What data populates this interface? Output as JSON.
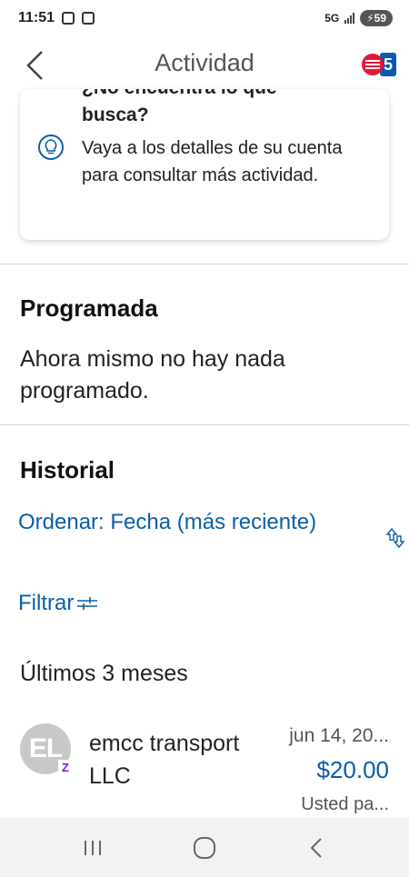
{
  "status_bar": {
    "time": "11:51",
    "network": "5G",
    "battery": "59"
  },
  "header": {
    "title": "Actividad",
    "logo_badge": "5",
    "logo_color": "#e31837",
    "badge_color": "#0b59b5"
  },
  "info_card": {
    "title_cut": "¿No encuentra lo que",
    "title": "busca?",
    "text": "Vaya a los detalles de su cuenta para consultar más actividad.",
    "icon": "lightbulb-icon"
  },
  "scheduled": {
    "heading": "Programada",
    "message": "Ahora mismo no hay nada programado."
  },
  "history": {
    "heading": "Historial",
    "sort_label": "Ordenar: Fecha (más reciente)",
    "filter_label": "Filtrar",
    "period": "Últimos 3 meses"
  },
  "transactions": [
    {
      "initials": "EL",
      "name": "emcc transport LLC",
      "date": "jun 14, 20...",
      "amount": "$20.00",
      "status": "Usted pa..."
    }
  ],
  "colors": {
    "link": "#0b5ea8",
    "zelle": "#6d1ed4"
  }
}
